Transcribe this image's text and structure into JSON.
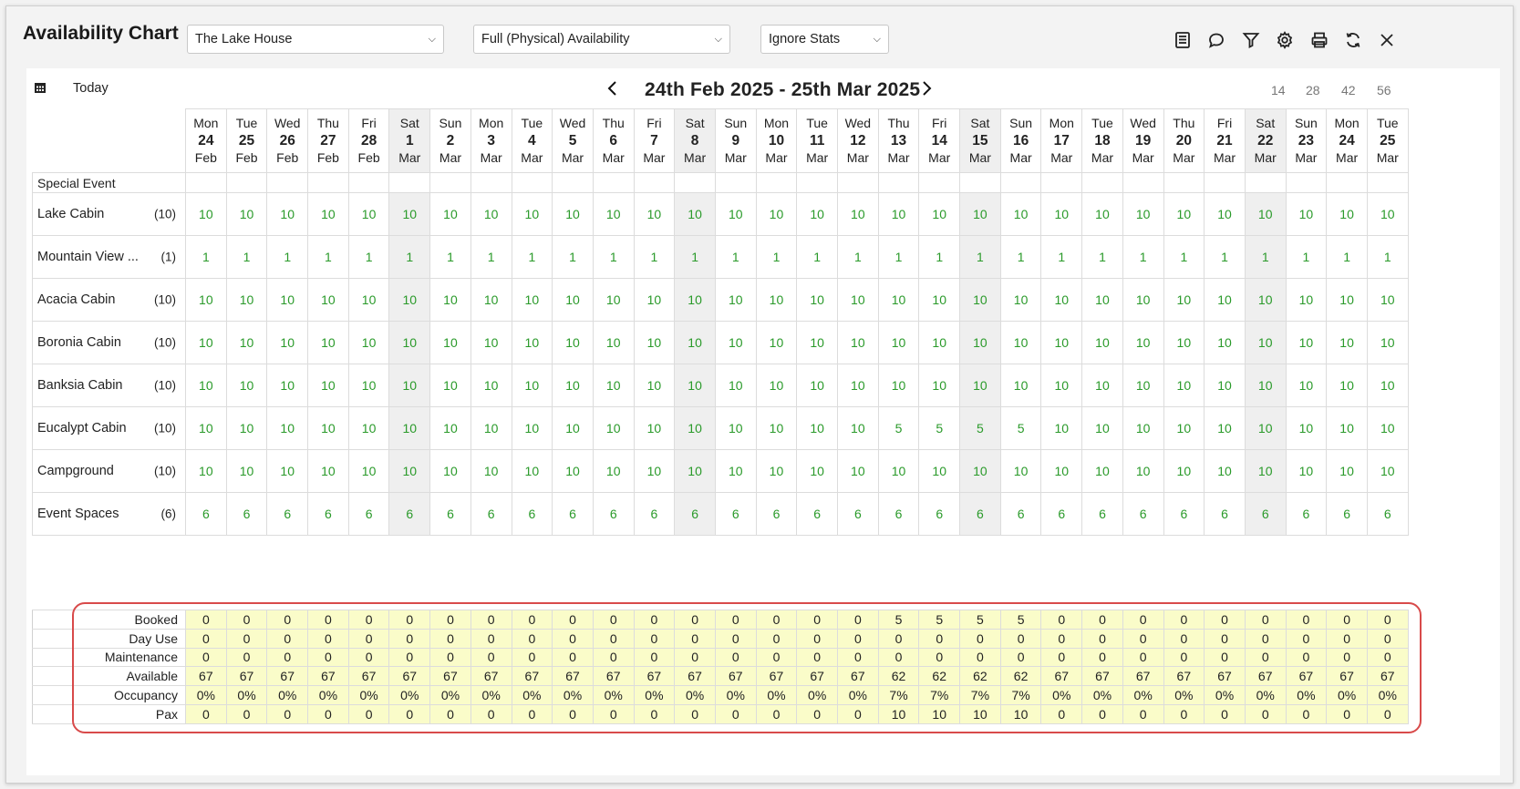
{
  "window": {
    "title": "Availability Chart",
    "property_select": "The Lake House",
    "availability_select": "Full (Physical) Availability",
    "stats_select": "Ignore Stats"
  },
  "toolbar": {
    "icons": [
      "report-icon",
      "comment-icon",
      "filter-icon",
      "gear-icon",
      "print-icon",
      "refresh-icon",
      "close-icon"
    ]
  },
  "nav": {
    "today": "Today",
    "date_range": "24th Feb 2025 - 25th Mar 2025",
    "zoom_options": [
      "14",
      "28",
      "42",
      "56"
    ]
  },
  "days": [
    {
      "dow": "Mon",
      "num": "24",
      "mon": "Feb"
    },
    {
      "dow": "Tue",
      "num": "25",
      "mon": "Feb"
    },
    {
      "dow": "Wed",
      "num": "26",
      "mon": "Feb"
    },
    {
      "dow": "Thu",
      "num": "27",
      "mon": "Feb"
    },
    {
      "dow": "Fri",
      "num": "28",
      "mon": "Feb"
    },
    {
      "dow": "Sat",
      "num": "1",
      "mon": "Mar",
      "weekend": true
    },
    {
      "dow": "Sun",
      "num": "2",
      "mon": "Mar"
    },
    {
      "dow": "Mon",
      "num": "3",
      "mon": "Mar"
    },
    {
      "dow": "Tue",
      "num": "4",
      "mon": "Mar"
    },
    {
      "dow": "Wed",
      "num": "5",
      "mon": "Mar"
    },
    {
      "dow": "Thu",
      "num": "6",
      "mon": "Mar"
    },
    {
      "dow": "Fri",
      "num": "7",
      "mon": "Mar"
    },
    {
      "dow": "Sat",
      "num": "8",
      "mon": "Mar",
      "weekend": true
    },
    {
      "dow": "Sun",
      "num": "9",
      "mon": "Mar"
    },
    {
      "dow": "Mon",
      "num": "10",
      "mon": "Mar"
    },
    {
      "dow": "Tue",
      "num": "11",
      "mon": "Mar"
    },
    {
      "dow": "Wed",
      "num": "12",
      "mon": "Mar"
    },
    {
      "dow": "Thu",
      "num": "13",
      "mon": "Mar"
    },
    {
      "dow": "Fri",
      "num": "14",
      "mon": "Mar"
    },
    {
      "dow": "Sat",
      "num": "15",
      "mon": "Mar",
      "weekend": true
    },
    {
      "dow": "Sun",
      "num": "16",
      "mon": "Mar"
    },
    {
      "dow": "Mon",
      "num": "17",
      "mon": "Mar"
    },
    {
      "dow": "Tue",
      "num": "18",
      "mon": "Mar"
    },
    {
      "dow": "Wed",
      "num": "19",
      "mon": "Mar"
    },
    {
      "dow": "Thu",
      "num": "20",
      "mon": "Mar"
    },
    {
      "dow": "Fri",
      "num": "21",
      "mon": "Mar"
    },
    {
      "dow": "Sat",
      "num": "22",
      "mon": "Mar",
      "weekend": true
    },
    {
      "dow": "Sun",
      "num": "23",
      "mon": "Mar"
    },
    {
      "dow": "Mon",
      "num": "24",
      "mon": "Mar"
    },
    {
      "dow": "Tue",
      "num": "25",
      "mon": "Mar"
    }
  ],
  "special_event_label": "Special Event",
  "rooms": [
    {
      "name": "Lake Cabin",
      "count": "(10)",
      "values": [
        "10",
        "10",
        "10",
        "10",
        "10",
        "10",
        "10",
        "10",
        "10",
        "10",
        "10",
        "10",
        "10",
        "10",
        "10",
        "10",
        "10",
        "10",
        "10",
        "10",
        "10",
        "10",
        "10",
        "10",
        "10",
        "10",
        "10",
        "10",
        "10",
        "10"
      ]
    },
    {
      "name": "Mountain View ...",
      "count": "(1)",
      "values": [
        "1",
        "1",
        "1",
        "1",
        "1",
        "1",
        "1",
        "1",
        "1",
        "1",
        "1",
        "1",
        "1",
        "1",
        "1",
        "1",
        "1",
        "1",
        "1",
        "1",
        "1",
        "1",
        "1",
        "1",
        "1",
        "1",
        "1",
        "1",
        "1",
        "1"
      ]
    },
    {
      "name": "Acacia Cabin",
      "count": "(10)",
      "values": [
        "10",
        "10",
        "10",
        "10",
        "10",
        "10",
        "10",
        "10",
        "10",
        "10",
        "10",
        "10",
        "10",
        "10",
        "10",
        "10",
        "10",
        "10",
        "10",
        "10",
        "10",
        "10",
        "10",
        "10",
        "10",
        "10",
        "10",
        "10",
        "10",
        "10"
      ]
    },
    {
      "name": "Boronia Cabin",
      "count": "(10)",
      "values": [
        "10",
        "10",
        "10",
        "10",
        "10",
        "10",
        "10",
        "10",
        "10",
        "10",
        "10",
        "10",
        "10",
        "10",
        "10",
        "10",
        "10",
        "10",
        "10",
        "10",
        "10",
        "10",
        "10",
        "10",
        "10",
        "10",
        "10",
        "10",
        "10",
        "10"
      ]
    },
    {
      "name": "Banksia Cabin",
      "count": "(10)",
      "values": [
        "10",
        "10",
        "10",
        "10",
        "10",
        "10",
        "10",
        "10",
        "10",
        "10",
        "10",
        "10",
        "10",
        "10",
        "10",
        "10",
        "10",
        "10",
        "10",
        "10",
        "10",
        "10",
        "10",
        "10",
        "10",
        "10",
        "10",
        "10",
        "10",
        "10"
      ]
    },
    {
      "name": "Eucalypt Cabin",
      "count": "(10)",
      "values": [
        "10",
        "10",
        "10",
        "10",
        "10",
        "10",
        "10",
        "10",
        "10",
        "10",
        "10",
        "10",
        "10",
        "10",
        "10",
        "10",
        "10",
        "5",
        "5",
        "5",
        "5",
        "10",
        "10",
        "10",
        "10",
        "10",
        "10",
        "10",
        "10",
        "10"
      ]
    },
    {
      "name": "Campground",
      "count": "(10)",
      "values": [
        "10",
        "10",
        "10",
        "10",
        "10",
        "10",
        "10",
        "10",
        "10",
        "10",
        "10",
        "10",
        "10",
        "10",
        "10",
        "10",
        "10",
        "10",
        "10",
        "10",
        "10",
        "10",
        "10",
        "10",
        "10",
        "10",
        "10",
        "10",
        "10",
        "10"
      ]
    },
    {
      "name": "Event Spaces",
      "count": "(6)",
      "values": [
        "6",
        "6",
        "6",
        "6",
        "6",
        "6",
        "6",
        "6",
        "6",
        "6",
        "6",
        "6",
        "6",
        "6",
        "6",
        "6",
        "6",
        "6",
        "6",
        "6",
        "6",
        "6",
        "6",
        "6",
        "6",
        "6",
        "6",
        "6",
        "6",
        "6"
      ]
    }
  ],
  "stats": [
    {
      "label": "Booked",
      "values": [
        "0",
        "0",
        "0",
        "0",
        "0",
        "0",
        "0",
        "0",
        "0",
        "0",
        "0",
        "0",
        "0",
        "0",
        "0",
        "0",
        "0",
        "5",
        "5",
        "5",
        "5",
        "0",
        "0",
        "0",
        "0",
        "0",
        "0",
        "0",
        "0",
        "0"
      ]
    },
    {
      "label": "Day Use",
      "values": [
        "0",
        "0",
        "0",
        "0",
        "0",
        "0",
        "0",
        "0",
        "0",
        "0",
        "0",
        "0",
        "0",
        "0",
        "0",
        "0",
        "0",
        "0",
        "0",
        "0",
        "0",
        "0",
        "0",
        "0",
        "0",
        "0",
        "0",
        "0",
        "0",
        "0"
      ]
    },
    {
      "label": "Maintenance",
      "values": [
        "0",
        "0",
        "0",
        "0",
        "0",
        "0",
        "0",
        "0",
        "0",
        "0",
        "0",
        "0",
        "0",
        "0",
        "0",
        "0",
        "0",
        "0",
        "0",
        "0",
        "0",
        "0",
        "0",
        "0",
        "0",
        "0",
        "0",
        "0",
        "0",
        "0"
      ]
    },
    {
      "label": "Available",
      "values": [
        "67",
        "67",
        "67",
        "67",
        "67",
        "67",
        "67",
        "67",
        "67",
        "67",
        "67",
        "67",
        "67",
        "67",
        "67",
        "67",
        "67",
        "62",
        "62",
        "62",
        "62",
        "67",
        "67",
        "67",
        "67",
        "67",
        "67",
        "67",
        "67",
        "67"
      ]
    },
    {
      "label": "Occupancy",
      "values": [
        "0%",
        "0%",
        "0%",
        "0%",
        "0%",
        "0%",
        "0%",
        "0%",
        "0%",
        "0%",
        "0%",
        "0%",
        "0%",
        "0%",
        "0%",
        "0%",
        "0%",
        "7%",
        "7%",
        "7%",
        "7%",
        "0%",
        "0%",
        "0%",
        "0%",
        "0%",
        "0%",
        "0%",
        "0%",
        "0%"
      ]
    },
    {
      "label": "Pax",
      "values": [
        "0",
        "0",
        "0",
        "0",
        "0",
        "0",
        "0",
        "0",
        "0",
        "0",
        "0",
        "0",
        "0",
        "0",
        "0",
        "0",
        "0",
        "10",
        "10",
        "10",
        "10",
        "0",
        "0",
        "0",
        "0",
        "0",
        "0",
        "0",
        "0",
        "0"
      ]
    }
  ],
  "colors": {
    "available_text": "#2a9a2a",
    "weekend_bg": "#efefef",
    "stats_bg": "#fafcc9",
    "highlight_border": "#d84a4a"
  }
}
